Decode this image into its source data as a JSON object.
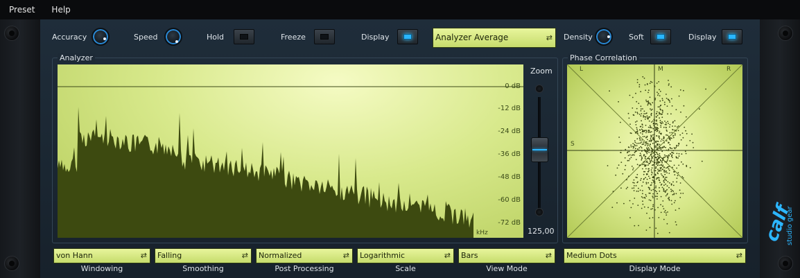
{
  "menu": {
    "preset": "Preset",
    "help": "Help"
  },
  "top_controls": {
    "accuracy_label": "Accuracy",
    "speed_label": "Speed",
    "hold_label": "Hold",
    "freeze_label": "Freeze",
    "display_label": "Display",
    "analyzer_mode": "Analyzer Average",
    "density_label": "Density",
    "soft_label": "Soft",
    "display2_label": "Display"
  },
  "analyzer": {
    "title": "Analyzer",
    "db_ticks": [
      "0 dB",
      "-12 dB",
      "-24 dB",
      "-36 dB",
      "-48 dB",
      "-60 dB",
      "-72 dB"
    ],
    "khz_label": "kHz",
    "zoom_label": "Zoom",
    "zoom_value": "125,00%"
  },
  "phase": {
    "title": "Phase Correlation",
    "label_l": "L",
    "label_m": "M",
    "label_r": "R",
    "label_s": "S"
  },
  "bottom_selects": [
    {
      "value": "von Hann",
      "label": "Windowing"
    },
    {
      "value": "Falling",
      "label": "Smoothing"
    },
    {
      "value": "Normalized",
      "label": "Post Processing"
    },
    {
      "value": "Logarithmic",
      "label": "Scale"
    },
    {
      "value": "Bars",
      "label": "View Mode"
    },
    {
      "value": "Medium Dots",
      "label": "Display Mode"
    }
  ],
  "logo": {
    "line1": "calf",
    "line2": "studio gear"
  },
  "colors": {
    "accent": "#2cb6ff",
    "lcd": "#d8e98c",
    "spectrum": "#3d4a10"
  }
}
